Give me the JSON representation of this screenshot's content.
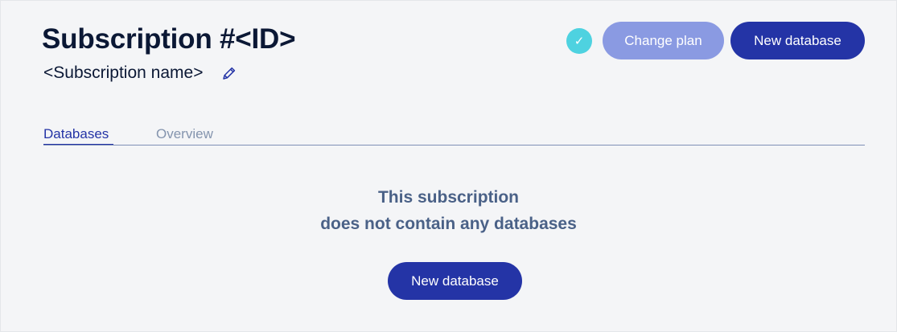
{
  "header": {
    "title": "Subscription #<ID>",
    "subtitle": "<Subscription name>",
    "edit_icon": "pencil-icon",
    "status_icon": "check-icon",
    "status_glyph": "✓"
  },
  "actions": {
    "change_plan_label": "Change plan",
    "new_database_label": "New database"
  },
  "tabs": [
    {
      "label": "Databases",
      "active": true
    },
    {
      "label": "Overview",
      "active": false
    }
  ],
  "empty_state": {
    "line1": "This subscription",
    "line2": "does not contain any databases",
    "button_label": "New database"
  },
  "colors": {
    "primary": "#2434a6",
    "primary_light": "#8a9ae2",
    "status": "#4ed2e0",
    "title_text": "#0b1835",
    "muted_text": "#4a6187",
    "background": "#f4f5f7"
  }
}
